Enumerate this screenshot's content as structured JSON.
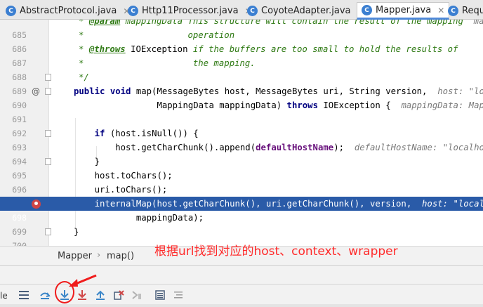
{
  "tabs": [
    {
      "label": "AbstractProtocol.java",
      "icon": "class-icon"
    },
    {
      "label": "Http11Processor.java",
      "icon": "class-icon"
    },
    {
      "label": "CoyoteAdapter.java",
      "icon": "class-icon"
    },
    {
      "label": "Mapper.java",
      "icon": "class-icon",
      "active": true
    },
    {
      "label": "Reque",
      "icon": "class-icon"
    }
  ],
  "editor": {
    "lines": [
      {
        "num": "685",
        "text": "* @param mappingData This structure will contain the result of the mapping  mapping"
      },
      {
        "num": "686",
        "text": "*                    operation"
      },
      {
        "num": "687",
        "text": "* @throws IOException if the buffers are too small to hold the results of"
      },
      {
        "num": "688",
        "text": "*                     the mapping."
      },
      {
        "num": "689",
        "text": "*/"
      },
      {
        "num": "690",
        "text": "public void map(MessageBytes host, MessageBytes uri, String version,  host: \"localho"
      },
      {
        "num": "691",
        "text": "                MappingData mappingData) throws IOException {  mappingData: MappingD"
      },
      {
        "num": "692",
        "text": ""
      },
      {
        "num": "693",
        "text": "    if (host.isNull()) {"
      },
      {
        "num": "694",
        "text": "        host.getCharChunk().append(defaultHostName);  defaultHostName: \"localhost\""
      },
      {
        "num": "695",
        "text": "    }"
      },
      {
        "num": "696",
        "text": "    host.toChars();"
      },
      {
        "num": "697",
        "text": "    uri.toChars();"
      },
      {
        "num": "698",
        "text": "    internalMap(host.getCharChunk(), uri.getCharChunk(), version,  host: \"localhost"
      },
      {
        "num": "699",
        "text": "            mappingData);"
      },
      {
        "num": "700",
        "text": "}"
      },
      {
        "num": "701",
        "text": ""
      }
    ],
    "current_line": "698",
    "override_marker": "@"
  },
  "breadcrumb": {
    "items": [
      "Mapper",
      "map()"
    ],
    "separator": "›"
  },
  "annotation_text": "根据url找到对应的host、context、wrapper",
  "debugger": {
    "left_label": "le",
    "buttons": [
      "menu-icon",
      "show-execution-point-icon",
      "step-over-icon",
      "step-into-icon",
      "force-step-into-icon",
      "step-out-icon",
      "drop-frame-icon",
      "run-to-cursor-icon",
      "evaluate-expression-icon",
      "trace-icon"
    ]
  },
  "colors": {
    "accent": "#2a5ba8",
    "annotation": "#ff2a2a",
    "keyword": "#000080",
    "doc": "#2f7a14"
  }
}
